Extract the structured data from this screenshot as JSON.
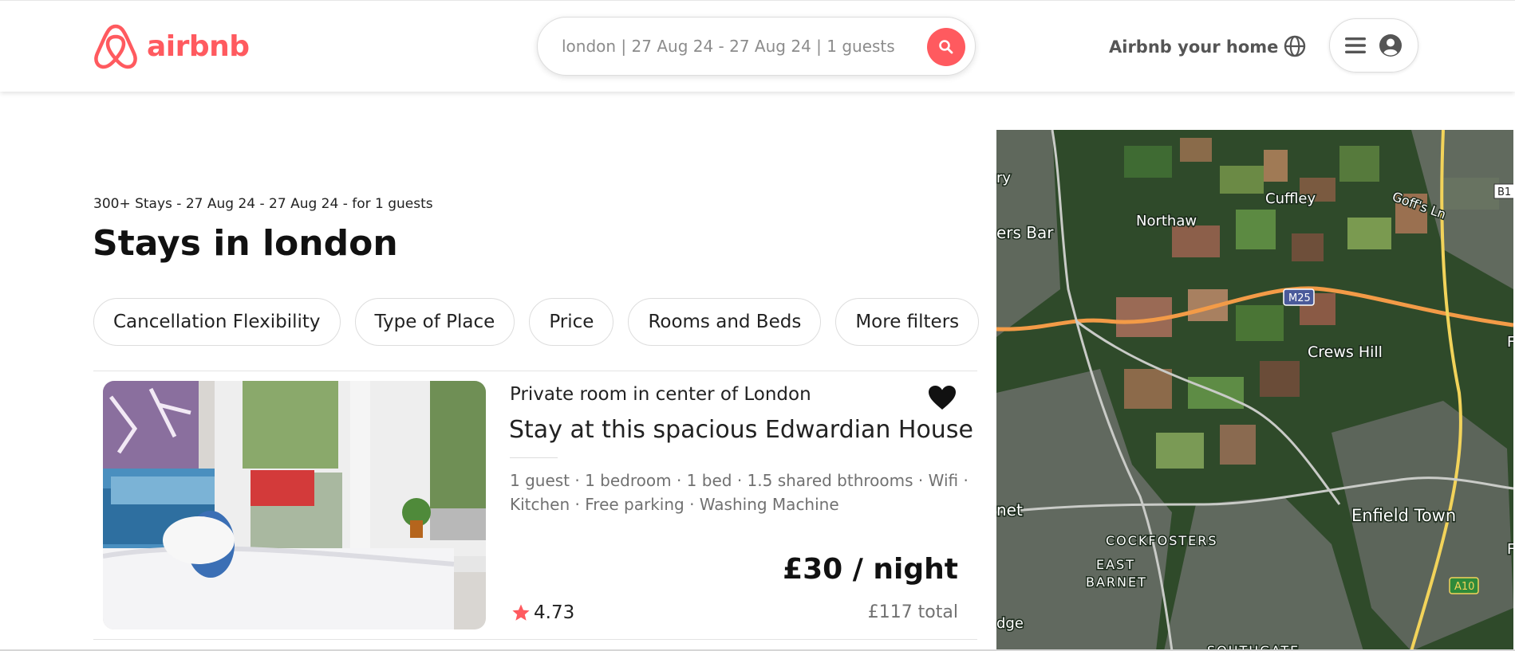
{
  "brand": {
    "name": "airbnb",
    "color": "#ff5a5f"
  },
  "header": {
    "search_text": "london | 27 Aug 24 - 27 Aug 24 | 1 guests",
    "host_link": "Airbnb your home",
    "icons": [
      "search-icon",
      "globe-icon",
      "menu-icon",
      "user-icon"
    ]
  },
  "results": {
    "summary": "300+ Stays - 27 Aug 24 - 27 Aug 24 - for 1 guests",
    "title": "Stays in london"
  },
  "filters": [
    "Cancellation Flexibility",
    "Type of Place",
    "Price",
    "Rooms and Beds",
    "More filters"
  ],
  "listing": {
    "type": "Private room in center of London",
    "title": "Stay at this spacious Edwardian House",
    "amenities": "1 guest · 1 bedroom · 1 bed · 1.5 shared bthrooms · Wifi · Kitchen · Free parking · Washing Machine",
    "price": "£30 / night",
    "rating": "4.73",
    "total": "£117 total",
    "favorited": true
  },
  "map": {
    "labels": [
      "Cuffley",
      "Northaw",
      "Goff's Ln",
      "ers Bar",
      "Crews Hill",
      "Enfield Town",
      "COCKFOSTERS",
      "EAST",
      "BARNET",
      "net",
      "dge",
      "SOUTHGATE",
      "ry",
      "B1",
      "F",
      "F"
    ],
    "road_shields": [
      "M25",
      "A10"
    ]
  }
}
